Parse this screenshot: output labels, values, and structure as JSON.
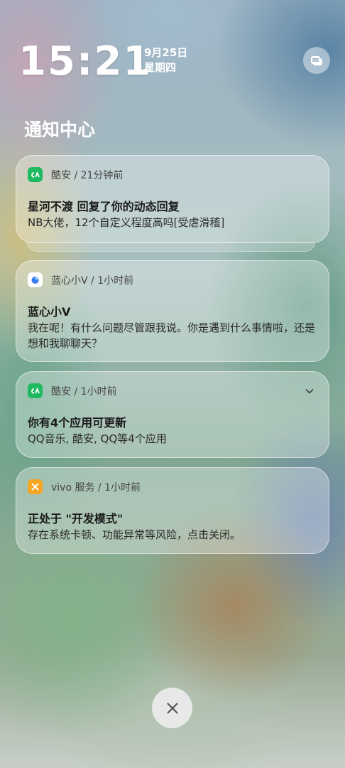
{
  "clock": {
    "time": "15:21",
    "date": "9月25日",
    "weekday": "星期四"
  },
  "header": {
    "title": "通知中心"
  },
  "notifications": [
    {
      "app": "酷安",
      "sep": "/",
      "time": "21分钟前",
      "head": "酷安 / 21分钟前",
      "title": "星河不渡 回复了你的动态回复",
      "body": "NB大佬，12个自定义程度高吗[受虐滑稽]",
      "icon": "coolapk-icon"
    },
    {
      "app": "蓝心小V",
      "head": "蓝心小V / 1小时前",
      "title": "蓝心小V",
      "body": "我在呢！有什么问题尽管跟我说。你是遇到什么事情啦，还是想和我聊聊天？",
      "icon": "bluelm-icon"
    },
    {
      "app": "酷安",
      "head": "酷安 / 1小时前",
      "title": "你有4个应用可更新",
      "body": "QQ音乐, 酷安, QQ等4个应用",
      "icon": "coolapk-icon"
    },
    {
      "app": "vivo服务",
      "head": "vivo 服务 / 1小时前",
      "title": "正处于 \"开发模式\"",
      "body": "存在系统卡顿、功能异常等风险，点击关闭。",
      "icon": "vivo-service-icon"
    }
  ],
  "colors": {
    "coolapk": "#1fb962",
    "vivo_service": "#f5a623",
    "bluelm": "#3a7bf6"
  }
}
